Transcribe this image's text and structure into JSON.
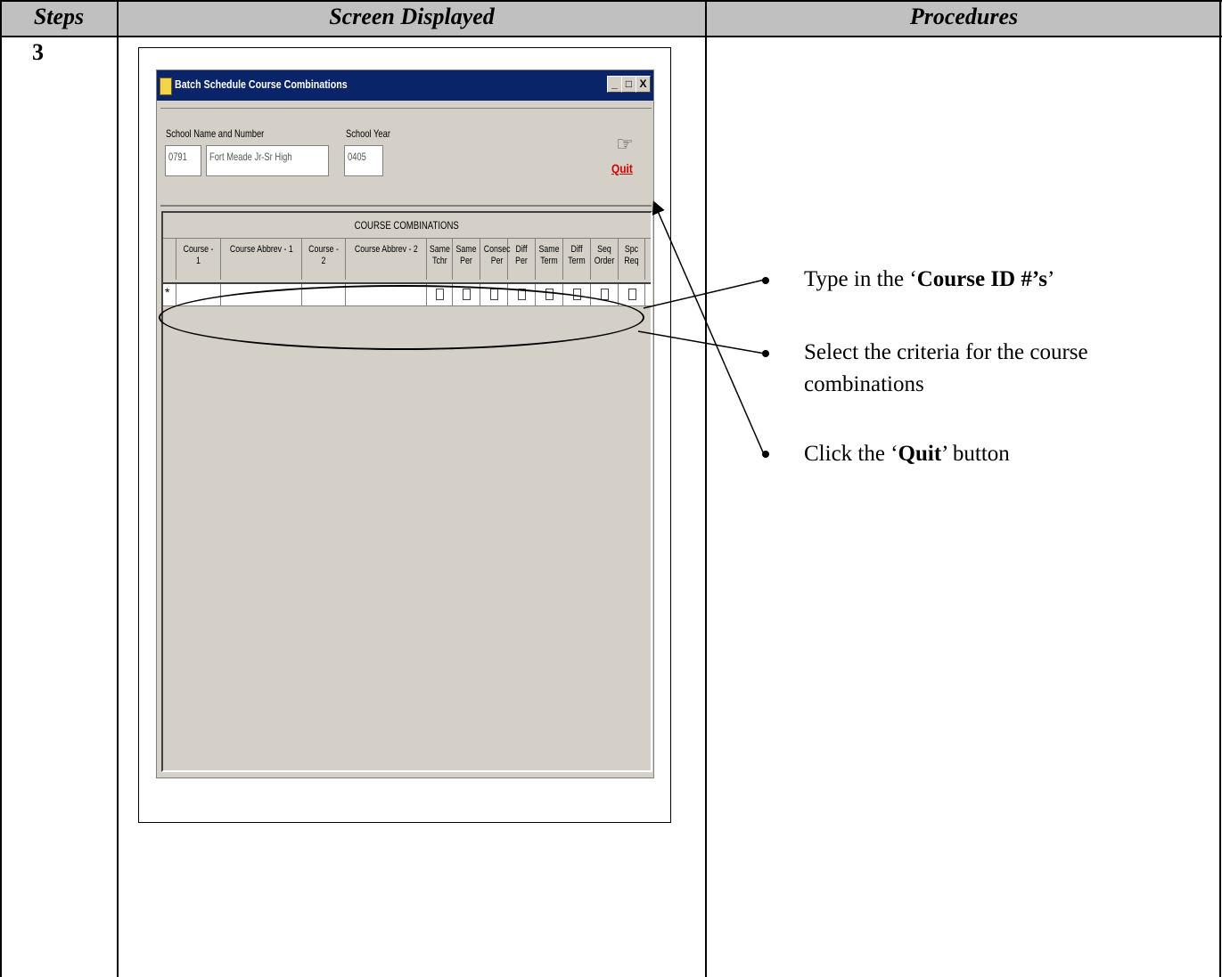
{
  "table": {
    "headers": [
      "Steps",
      "Screen Displayed",
      "Procedures"
    ],
    "step": "3"
  },
  "window": {
    "title": "Batch Schedule Course Combinations",
    "buttons": [
      "_",
      "□",
      "X"
    ],
    "school_label": "School Name and Number",
    "year_label": "School Year",
    "school_number": "0791",
    "school_name": "Fort Meade Jr-Sr High",
    "school_year": "0405",
    "quit_label": "Quit",
    "quit_icon": "pointing-hand-icon"
  },
  "grid": {
    "title": "COURSE COMBINATIONS",
    "columns": [
      "Course - 1",
      "Course Abbrev - 1",
      "Course - 2",
      "Course Abbrev - 2",
      "Same Tchr",
      "Same Per",
      "Consec Per",
      "Diff Per",
      "Same Term",
      "Diff Term",
      "Seq Order",
      "Spc Req"
    ],
    "row_indicator": "*"
  },
  "procedures": {
    "item1_prefix": "Type in the ‘",
    "item1_bold": "Course ID #’s",
    "item1_suffix": "’",
    "item2": "Select the criteria for the course combinations",
    "item3_prefix": "Click the ‘",
    "item3_bold": "Quit",
    "item3_suffix": "’ button"
  }
}
